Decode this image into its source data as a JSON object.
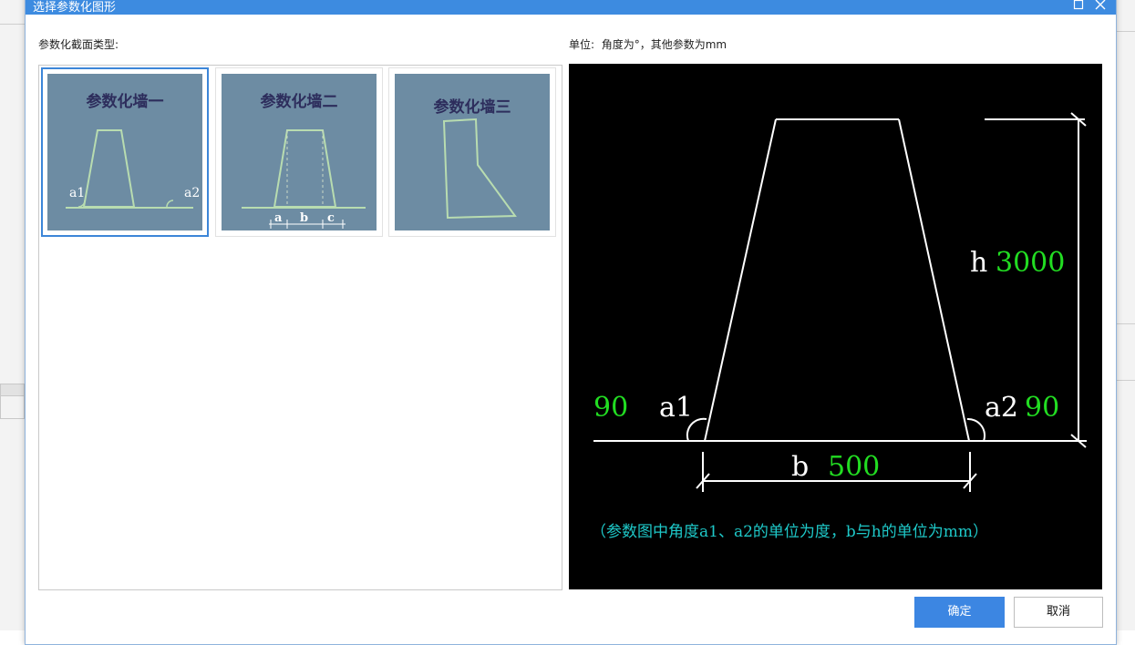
{
  "dialog": {
    "title": "选择参数化图形",
    "section_label": "参数化截面类型:",
    "units_label": "单位:",
    "units_text": "角度为°，其他参数为mm",
    "ok_label": "确定",
    "cancel_label": "取消"
  },
  "thumbnails": [
    {
      "title": "参数化墙一",
      "a1": "a1",
      "a2": "a2",
      "selected": true
    },
    {
      "title": "参数化墙二",
      "a": "a",
      "b": "b",
      "c": "c",
      "selected": false
    },
    {
      "title": "参数化墙三",
      "selected": false
    }
  ],
  "preview": {
    "h_label": "h",
    "h_value": "3000",
    "a1_label": "a1",
    "a1_value": "90",
    "a2_label": "a2",
    "a2_value": "90",
    "b_label": "b",
    "b_value": "500",
    "note": "（参数图中角度a1、a2的单位为度，b与h的单位为mm）"
  },
  "colors": {
    "titlebar": "#3d8be0",
    "preview_bg": "#000000",
    "value_green": "#22dd22",
    "note_cyan": "#1ec8c8",
    "thumb_bg": "#6d8ca3",
    "thumb_line": "#b8dcb0",
    "selected_border": "#3c86d8",
    "ok_button": "#3c86e2"
  }
}
